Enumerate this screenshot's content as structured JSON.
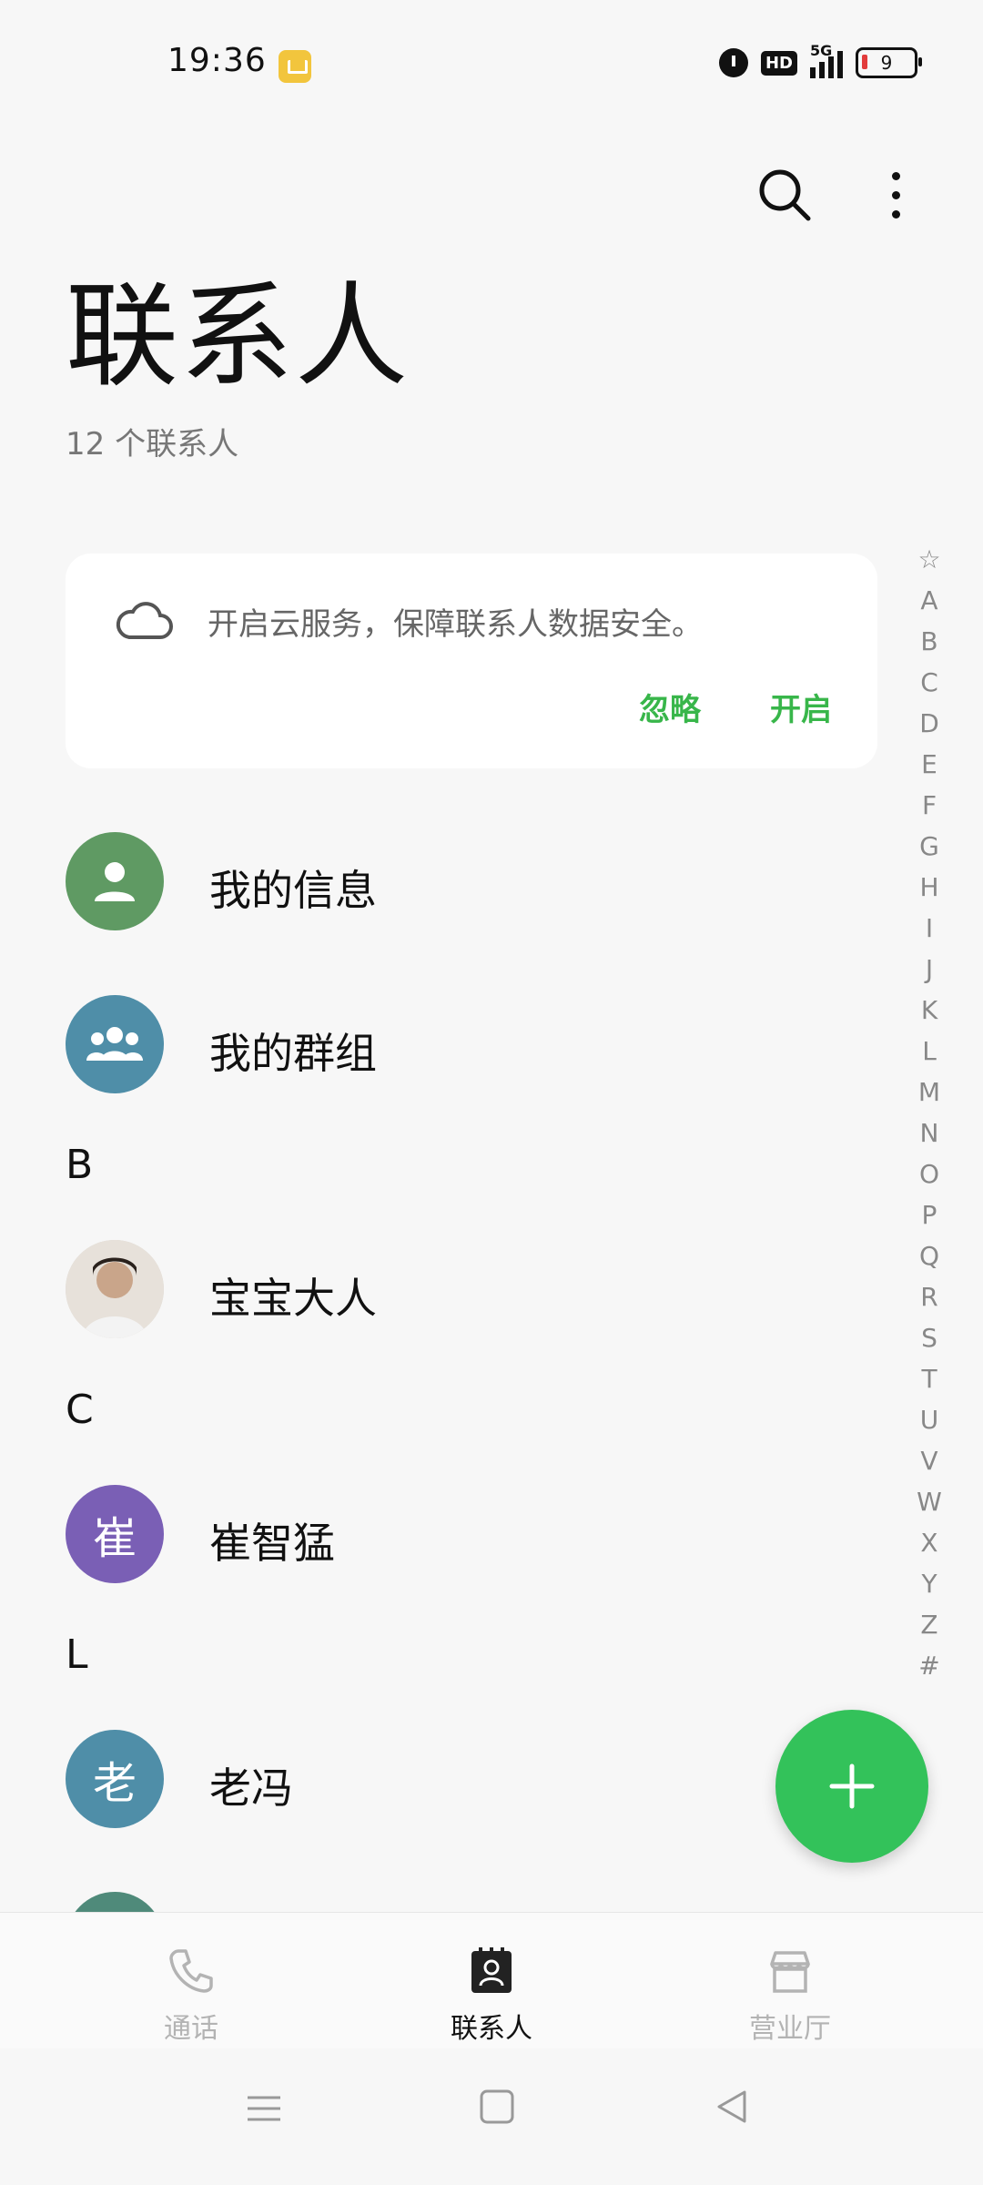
{
  "status_bar": {
    "time": "19:36",
    "hd": "HD",
    "network": "5G",
    "battery": "9"
  },
  "header": {
    "title": "联系人",
    "count": "12 个联系人"
  },
  "cloud_card": {
    "message": "开启云服务，保障联系人数据安全。",
    "ignore_label": "忽略",
    "enable_label": "开启"
  },
  "special_rows": [
    {
      "name": "我的信息",
      "avatar_color": "#5f9a63",
      "icon": "person-icon"
    },
    {
      "name": "我的群组",
      "avatar_color": "#4f8ea8",
      "icon": "group-icon"
    }
  ],
  "sections": [
    {
      "letter": "B",
      "contacts": [
        {
          "name": "宝宝大人",
          "avatar_type": "photo"
        }
      ]
    },
    {
      "letter": "C",
      "contacts": [
        {
          "name": "崔智猛",
          "avatar_text": "崔",
          "avatar_color": "#7a5fb5"
        }
      ]
    },
    {
      "letter": "L",
      "contacts": [
        {
          "name": "老冯",
          "avatar_text": "老",
          "avatar_color": "#4f8ea8"
        }
      ]
    }
  ],
  "alphabet": [
    "☆",
    "A",
    "B",
    "C",
    "D",
    "E",
    "F",
    "G",
    "H",
    "I",
    "J",
    "K",
    "L",
    "M",
    "N",
    "O",
    "P",
    "Q",
    "R",
    "S",
    "T",
    "U",
    "V",
    "W",
    "X",
    "Y",
    "Z",
    "#"
  ],
  "bottom_nav": {
    "calls": "通话",
    "contacts": "联系人",
    "hall": "营业厅"
  },
  "colors": {
    "accent_green": "#33c25a",
    "link_green": "#38b64a"
  }
}
